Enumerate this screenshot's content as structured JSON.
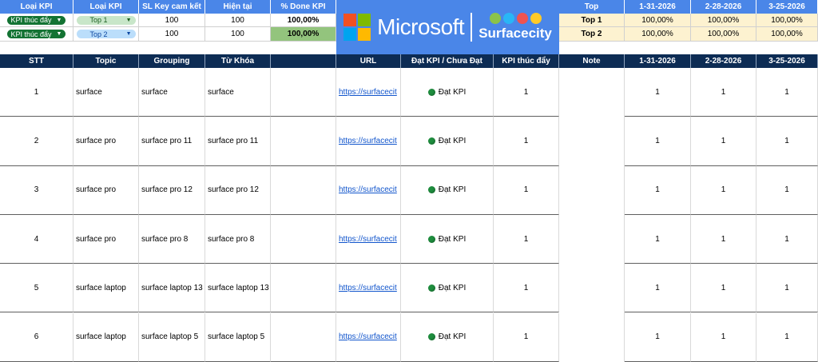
{
  "top_headers": [
    "Loại KPI",
    "Loại KPI",
    "SL Key cam kết",
    "Hiện tại",
    "% Done KPI"
  ],
  "top_rows": [
    {
      "type": "KPI thúc đẩy",
      "level": "Top 1",
      "committed": "100",
      "current": "100",
      "done": "100,00%"
    },
    {
      "type": "KPI thúc đẩy",
      "level": "Top 2",
      "committed": "100",
      "current": "100",
      "done": "100,00%"
    }
  ],
  "banner": {
    "microsoft": "Microsoft",
    "surfacecity": "Surfacecity"
  },
  "right_headers": [
    "Top",
    "1-31-2026",
    "2-28-2026",
    "3-25-2026"
  ],
  "right_rows": [
    {
      "top": "Top 1",
      "d1": "100,00%",
      "d2": "100,00%",
      "d3": "100,00%"
    },
    {
      "top": "Top 2",
      "d1": "100,00%",
      "d2": "100,00%",
      "d3": "100,00%"
    }
  ],
  "main_headers": [
    "STT",
    "Topic",
    "Grouping",
    "Từ Khóa",
    "",
    "URL",
    "Đạt KPI / Chưa Đạt",
    "KPI thúc đẩy",
    "Note",
    "1-31-2026",
    "2-28-2026",
    "3-25-2026"
  ],
  "rows": [
    {
      "stt": "1",
      "topic": "surface",
      "grouping": "surface",
      "keyword": "surface",
      "url": "https://surfacecit",
      "status": "Đạt KPI",
      "kpi": "1",
      "d1": "1",
      "d2": "1",
      "d3": "1"
    },
    {
      "stt": "2",
      "topic": "surface pro",
      "grouping": "surface pro 11",
      "keyword": "surface pro 11",
      "url": "https://surfacecit",
      "status": "Đạt KPI",
      "kpi": "1",
      "d1": "1",
      "d2": "1",
      "d3": "1"
    },
    {
      "stt": "3",
      "topic": "surface pro",
      "grouping": "surface pro 12",
      "keyword": "surface pro 12",
      "url": "https://surfacecit",
      "status": "Đạt KPI",
      "kpi": "1",
      "d1": "1",
      "d2": "1",
      "d3": "1"
    },
    {
      "stt": "4",
      "topic": "surface pro",
      "grouping": "surface pro 8",
      "keyword": "surface pro 8",
      "url": "https://surfacecit",
      "status": "Đạt KPI",
      "kpi": "1",
      "d1": "1",
      "d2": "1",
      "d3": "1"
    },
    {
      "stt": "5",
      "topic": "surface laptop",
      "grouping": "surface laptop 13",
      "keyword": "surface laptop 13",
      "url": "https://surfacecit",
      "status": "Đạt KPI",
      "kpi": "1",
      "d1": "1",
      "d2": "1",
      "d3": "1"
    },
    {
      "stt": "6",
      "topic": "surface laptop",
      "grouping": "surface laptop 5",
      "keyword": "surface laptop 5",
      "url": "https://surfacecit",
      "status": "Đạt KPI",
      "kpi": "1",
      "d1": "1",
      "d2": "1",
      "d3": "1"
    }
  ],
  "colors": {
    "header_blue": "#4a86e8",
    "header_navy": "#0d2c54",
    "green_done": "#93c47d",
    "status_green": "#1e8e3e",
    "link": "#1155cc",
    "top_row_cream": "#fdf2d0"
  }
}
